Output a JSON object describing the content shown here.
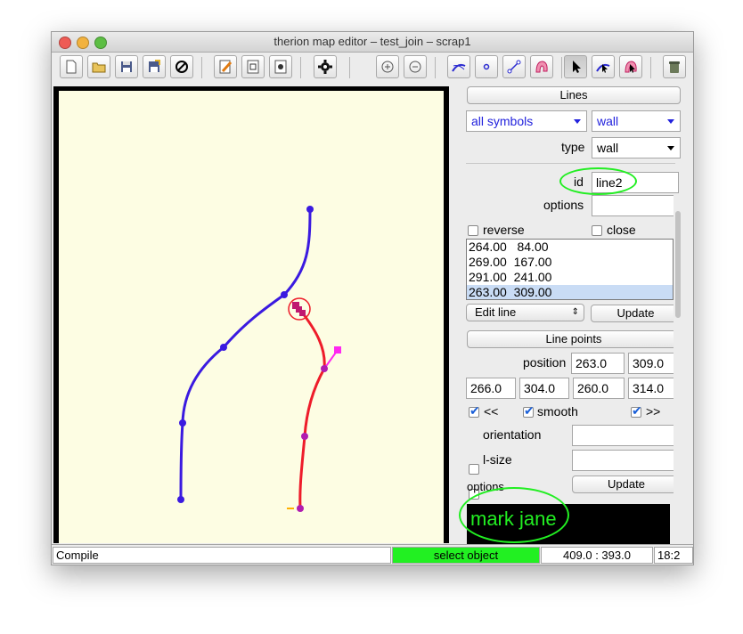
{
  "window": {
    "title": "therion map editor – test_join – scrap1"
  },
  "toolbar": {
    "tools": [
      "new-file-icon",
      "open-folder-icon",
      "save-icon",
      "save-as-icon",
      "close-icon",
      "edit-text-icon",
      "edit-image-icon",
      "settings-icon",
      "compile-gear-icon",
      "zoom-in-icon",
      "zoom-out-icon",
      "insert-line-icon",
      "insert-point-icon",
      "insert-line-point-icon",
      "insert-area-icon",
      "select-pointer-icon",
      "select-line-icon",
      "select-area-icon",
      "trash-icon"
    ]
  },
  "panel": {
    "section_title": "Lines",
    "symbols_value": "all symbols",
    "wall_value": "wall",
    "type_label": "type",
    "type_value": "wall",
    "id_label": "id",
    "id_value": "line2",
    "options_label": "options",
    "options_value": "",
    "reverse_label": "reverse",
    "close_label": "close",
    "points": [
      "264.00   84.00",
      "269.00  167.00",
      "291.00  241.00",
      "263.00  309.00"
    ],
    "edit_mode": "Edit line",
    "update_label": "Update",
    "line_points_title": "Line points",
    "position_label": "position",
    "position_x": "263.0",
    "position_y": "309.0",
    "cp1_x": "266.0",
    "cp1_y": "304.0",
    "cp2_x": "260.0",
    "cp2_y": "314.0",
    "prev_label": "<<",
    "smooth_label": "smooth",
    "next_label": ">>",
    "orientation_label": "orientation",
    "lsize_label": "l-size",
    "options2_label": "options",
    "update2_label": "Update",
    "annotation_text": "mark jane"
  },
  "status": {
    "left": "Compile",
    "mode": "select object",
    "coords": "409.0 : 393.0",
    "zoom": "18:2"
  },
  "colors": {
    "accent_green": "#22ee22",
    "status_green": "#22f022",
    "line_blue": "#3a1ae0",
    "line_red": "#ee1c2a",
    "canvas_bg": "#fdfde3"
  }
}
